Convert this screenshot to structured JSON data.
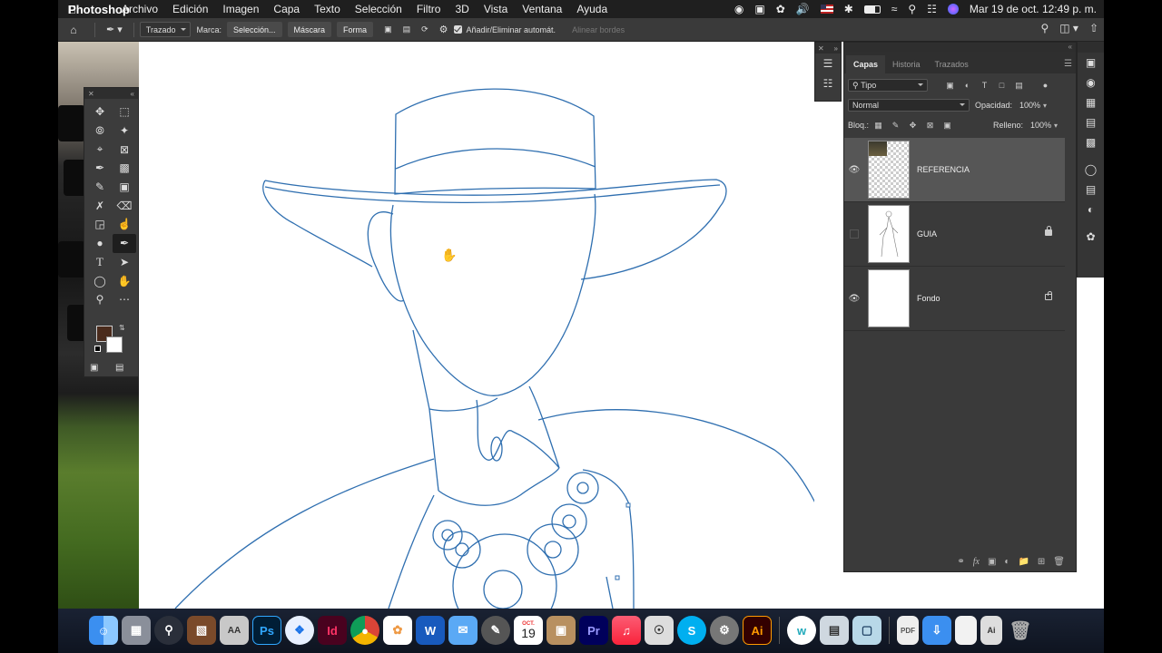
{
  "menubar": {
    "app": "Photoshop",
    "items": [
      "Archivo",
      "Edición",
      "Imagen",
      "Capa",
      "Texto",
      "Selección",
      "Filtro",
      "3D",
      "Vista",
      "Ventana",
      "Ayuda"
    ],
    "datetime": "Mar 19 de oct.  12:49 p. m."
  },
  "options": {
    "mode": "Trazado",
    "mark_label": "Marca:",
    "selection_btn": "Selección...",
    "mask_btn": "Máscara",
    "shape_btn": "Forma",
    "auto_label": "Añadir/Eliminar automát.",
    "align_label": "Alinear bordes"
  },
  "layers_panel": {
    "tabs": [
      "Capas",
      "Historia",
      "Trazados"
    ],
    "filter_kind": "Tipo",
    "blend_mode": "Normal",
    "opacity_label": "Opacidad:",
    "opacity": "100%",
    "lock_label": "Bloq.:",
    "fill_label": "Relleno:",
    "fill": "100%",
    "layers": [
      {
        "name": "REFERENCIA",
        "visible": true,
        "locked": false,
        "selected": true
      },
      {
        "name": "GUIA",
        "visible": false,
        "locked": true,
        "selected": false
      },
      {
        "name": "Fondo",
        "visible": true,
        "locked": true,
        "selected": false
      }
    ]
  },
  "dock": {
    "calendar_month": "OCT.",
    "calendar_day": "19",
    "apps": [
      "finder",
      "launchpad",
      "quicktime",
      "zip",
      "font-book",
      "photoshop",
      "safari",
      "indesign",
      "chrome",
      "photos",
      "word",
      "mail",
      "scripting",
      "calendar",
      "app",
      "premiere",
      "music",
      "screenshot",
      "skype",
      "settings",
      "illustrator",
      "wunderbucket",
      "preview",
      "finder2",
      "pdf",
      "folder",
      "doc",
      "doc2",
      "trash"
    ]
  },
  "colors": {
    "path": "#2f6fb0",
    "foreground": "#4a2b1c",
    "background": "#ffffff"
  }
}
